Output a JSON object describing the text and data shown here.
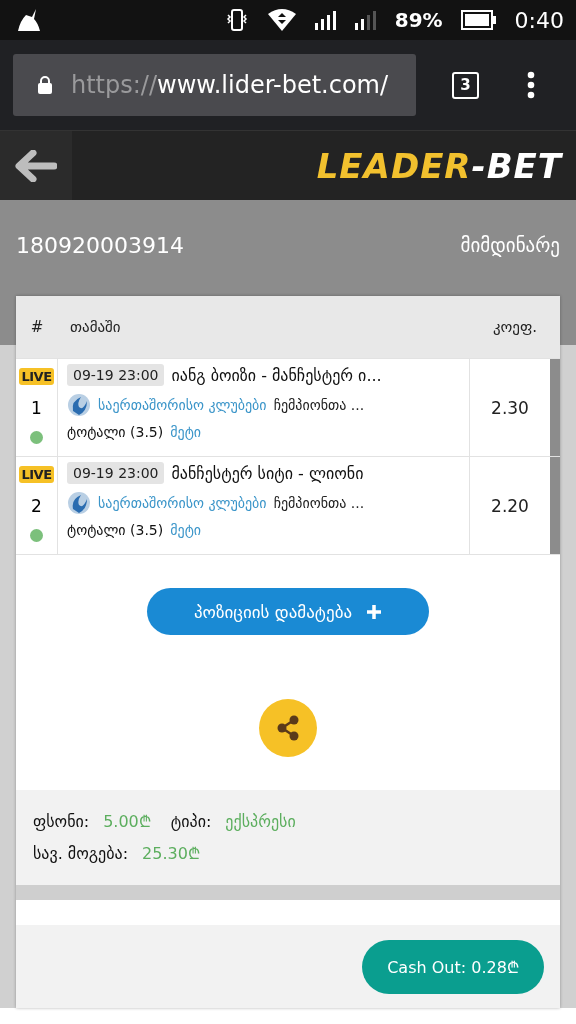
{
  "status_bar": {
    "battery": "89%",
    "time": "0:40"
  },
  "browser": {
    "url_scheme": "https://",
    "url_host": "www.lider-bet.com/",
    "tab_count": "3"
  },
  "logo": {
    "part_1": "LEADER",
    "part_2": "-BET"
  },
  "ticket": {
    "number": "180920003914",
    "status": "მიმდინარე"
  },
  "table": {
    "columns": [
      "#",
      "თამაში",
      "კოეფ."
    ],
    "rows": [
      {
        "badge": "LIVE",
        "number": "1",
        "color": "#7cc07c",
        "date": "09-19 23:00",
        "match": "იანგ ბოიზი - მანჩესტერ ი...",
        "category": "საერთაშორისო კლუბები",
        "league": "ჩემპიონთა ...",
        "market": "ტოტალი (3.5)",
        "pick": "მეტი",
        "odds": "2.30"
      },
      {
        "badge": "LIVE",
        "number": "2",
        "color": "#7cc07c",
        "date": "09-19 23:00",
        "match": "მანჩესტერ სიტი - ლიონი",
        "category": "საერთაშორისო კლუბები",
        "league": "ჩემპიონთა ...",
        "market": "ტოტალი (3.5)",
        "pick": "მეტი",
        "odds": "2.20"
      }
    ]
  },
  "add_button": "პოზიციის დამატება",
  "summary": {
    "stake_label": "ფსონი:",
    "stake": "5.00₾",
    "type_label": "ტიპი:",
    "type": "ექსპრესი",
    "win_label": "სავ. მოგება:",
    "win": "25.30₾"
  },
  "cash_out": "Cash Out: 0.28₾"
}
